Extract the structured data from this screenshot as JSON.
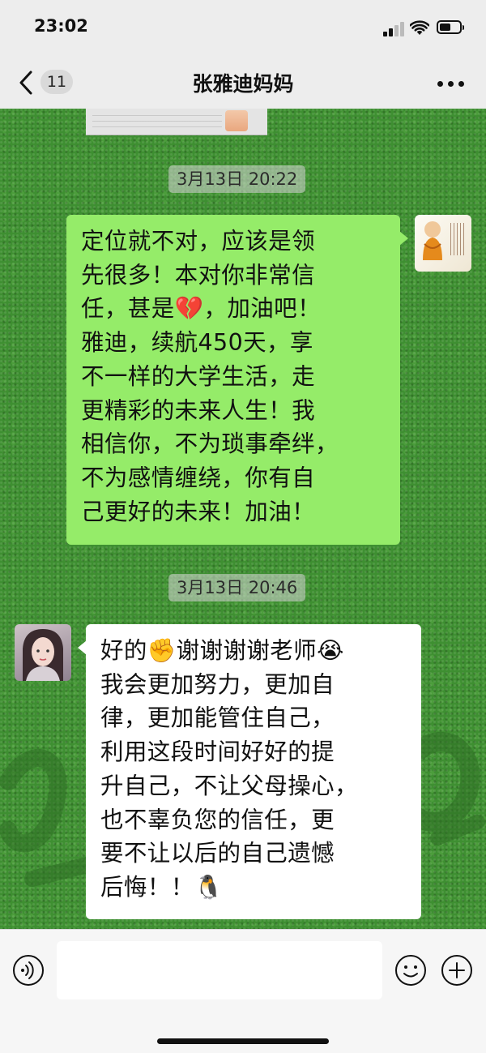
{
  "status_bar": {
    "time": "23:02"
  },
  "nav": {
    "back_count": "11",
    "title": "张雅迪妈妈"
  },
  "messages": [
    {
      "type": "timestamp",
      "text": "3月13日 20:22"
    },
    {
      "type": "sent",
      "lines": [
        "定位就不对，应该是领",
        "先很多！本对你非常信",
        "任，甚是💔，加油吧！",
        "雅迪，续航450天，享",
        "不一样的大学生活，走",
        "更精彩的未来人生！我",
        "相信你，不为琐事牵绊，",
        "不为感情缠绕，你有自",
        "己更好的未来！加油！"
      ]
    },
    {
      "type": "timestamp",
      "text": "3月13日 20:46"
    },
    {
      "type": "received",
      "lines": [
        "好的✊谢谢谢谢老师😭",
        "我会更加努力，更加自",
        "律，更加能管住自己，",
        "利用这段时间好好的提",
        "升自己，不让父母操心，",
        "也不辜负您的信任，更",
        "要不让以后的自己遗憾",
        "后悔！！🐧"
      ]
    }
  ],
  "input_bar": {
    "value": ""
  }
}
